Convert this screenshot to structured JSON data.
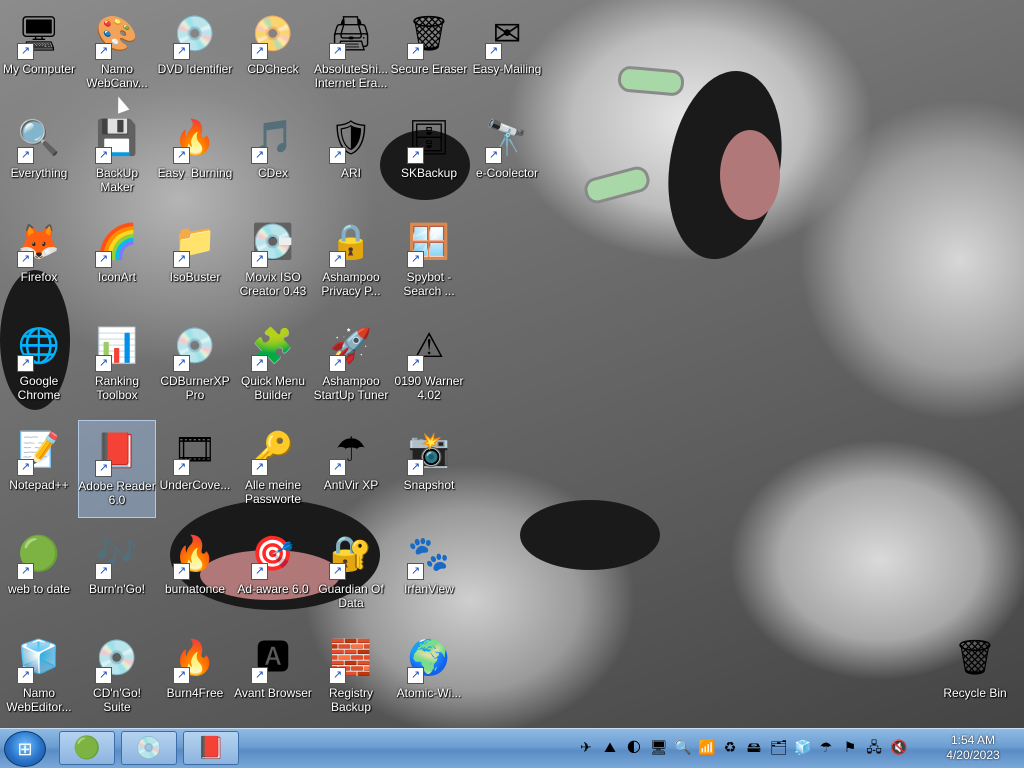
{
  "desktop_icons": [
    {
      "label": "My Computer",
      "icon": "computer-icon",
      "glyph": "🖥"
    },
    {
      "label": "Namo WebCanv...",
      "icon": "namo-webcanvas-icon",
      "glyph": "🎨"
    },
    {
      "label": "DVD Identifier",
      "icon": "dvd-identifier-icon",
      "glyph": "💿"
    },
    {
      "label": "CDCheck",
      "icon": "cdcheck-icon",
      "glyph": "📀"
    },
    {
      "label": "AbsoluteShi... Internet Era...",
      "icon": "absoluteshield-icon",
      "glyph": "🖨"
    },
    {
      "label": "Secure Eraser",
      "icon": "secure-eraser-icon",
      "glyph": "🗑"
    },
    {
      "label": "Easy-Mailing",
      "icon": "easy-mailing-icon",
      "glyph": "✉"
    },
    {
      "label": "Everything",
      "icon": "everything-icon",
      "glyph": "🔍"
    },
    {
      "label": "BackUp Maker",
      "icon": "backup-maker-icon",
      "glyph": "💾"
    },
    {
      "label": "Easy_Burning",
      "icon": "easy-burning-icon",
      "glyph": "🔥"
    },
    {
      "label": "CDex",
      "icon": "cdex-icon",
      "glyph": "🎵"
    },
    {
      "label": "ARI",
      "icon": "ari-icon",
      "glyph": "🛡"
    },
    {
      "label": "SKBackup",
      "icon": "skbackup-icon",
      "glyph": "🗄"
    },
    {
      "label": "e-Coolector",
      "icon": "e-coolector-icon",
      "glyph": "🔭"
    },
    {
      "label": "Firefox",
      "icon": "firefox-icon",
      "glyph": "🦊"
    },
    {
      "label": "IconArt",
      "icon": "iconart-icon",
      "glyph": "🌈"
    },
    {
      "label": "IsoBuster",
      "icon": "isobuster-icon",
      "glyph": "📁"
    },
    {
      "label": "Movix ISO Creator 0.43",
      "icon": "movix-iso-icon",
      "glyph": "💽"
    },
    {
      "label": "Ashampoo Privacy P...",
      "icon": "ashampoo-privacy-icon",
      "glyph": "🔒"
    },
    {
      "label": "Spybot - Search ...",
      "icon": "spybot-icon",
      "glyph": "🪟"
    },
    {
      "label": "Google Chrome",
      "icon": "chrome-icon",
      "glyph": "🌐"
    },
    {
      "label": "Ranking Toolbox",
      "icon": "ranking-toolbox-icon",
      "glyph": "📊"
    },
    {
      "label": "CDBurnerXP Pro",
      "icon": "cdburnerxp-icon",
      "glyph": "💿"
    },
    {
      "label": "Quick Menu Builder",
      "icon": "quick-menu-builder-icon",
      "glyph": "🧩"
    },
    {
      "label": "Ashampoo StartUp Tuner",
      "icon": "ashampoo-startup-icon",
      "glyph": "🚀"
    },
    {
      "label": "0190 Warner 4.02",
      "icon": "warner-icon",
      "glyph": "⚠"
    },
    {
      "label": "Notepad++",
      "icon": "notepadpp-icon",
      "glyph": "📝"
    },
    {
      "label": "Adobe Reader 6.0",
      "icon": "adobe-reader-icon",
      "glyph": "📕"
    },
    {
      "label": "UnderCove...",
      "icon": "undercover-icon",
      "glyph": "🎞"
    },
    {
      "label": "Alle meine Passworte",
      "icon": "passwords-icon",
      "glyph": "🔑"
    },
    {
      "label": "AntiVir XP",
      "icon": "antivir-icon",
      "glyph": "☂"
    },
    {
      "label": "Snapshot",
      "icon": "snapshot-icon",
      "glyph": "📸"
    },
    {
      "label": "web to date",
      "icon": "web-to-date-icon",
      "glyph": "🟢"
    },
    {
      "label": "Burn'n'Go!",
      "icon": "burn-n-go-icon",
      "glyph": "🎶"
    },
    {
      "label": "burnatonce",
      "icon": "burnatonce-icon",
      "glyph": "🔥"
    },
    {
      "label": "Ad-aware 6.0",
      "icon": "adaware-icon",
      "glyph": "🎯"
    },
    {
      "label": "Guardian Of Data",
      "icon": "guardian-of-data-icon",
      "glyph": "🔐"
    },
    {
      "label": "IrfanView",
      "icon": "irfanview-icon",
      "glyph": "🐾"
    },
    {
      "label": "Namo WebEditor...",
      "icon": "namo-webeditor-icon",
      "glyph": "🧊"
    },
    {
      "label": "CD'n'Go! Suite",
      "icon": "cdngo-suite-icon",
      "glyph": "💿"
    },
    {
      "label": "Burn4Free",
      "icon": "burn4free-icon",
      "glyph": "🔥"
    },
    {
      "label": "Avant Browser",
      "icon": "avant-browser-icon",
      "glyph": "🅰"
    },
    {
      "label": "Registry Backup",
      "icon": "registry-backup-icon",
      "glyph": "🧱"
    },
    {
      "label": "Atomic-Wi...",
      "icon": "atomic-wi-icon",
      "glyph": "🌍"
    },
    {
      "label": "Recycle Bin",
      "icon": "recycle-bin-icon",
      "glyph": "🗑"
    }
  ],
  "selected_icon": "Adobe Reader 6.0",
  "taskbar": {
    "start_icon": "windows-start-icon",
    "buttons": [
      {
        "name": "web-to-date-task",
        "icon": "web-to-date-icon",
        "glyph": "🟢"
      },
      {
        "name": "dvd-task",
        "icon": "disc-icon",
        "glyph": "💿"
      },
      {
        "name": "adobe-task",
        "icon": "adobe-reader-icon",
        "glyph": "📕"
      }
    ],
    "tray_icons": [
      {
        "icon": "tray-1-icon",
        "glyph": "✈"
      },
      {
        "icon": "tray-2-icon",
        "glyph": "⛰"
      },
      {
        "icon": "tray-3-icon",
        "glyph": "🌓"
      },
      {
        "icon": "tray-4-icon",
        "glyph": "🖥"
      },
      {
        "icon": "tray-5-icon",
        "glyph": "🔍"
      },
      {
        "icon": "tray-6-icon",
        "glyph": "📶"
      },
      {
        "icon": "tray-7-icon",
        "glyph": "♻"
      },
      {
        "icon": "tray-8-icon",
        "glyph": "🖴"
      },
      {
        "icon": "tray-9-icon",
        "glyph": "🗂"
      },
      {
        "icon": "tray-10-icon",
        "glyph": "🧊"
      },
      {
        "icon": "tray-11-icon",
        "glyph": "☂"
      },
      {
        "icon": "tray-12-icon",
        "glyph": "⚑"
      },
      {
        "icon": "tray-13-icon",
        "glyph": "🖧"
      },
      {
        "icon": "tray-14-icon",
        "glyph": "🔇"
      }
    ],
    "clock_time": "1:54 AM",
    "clock_date": "4/20/2023"
  }
}
